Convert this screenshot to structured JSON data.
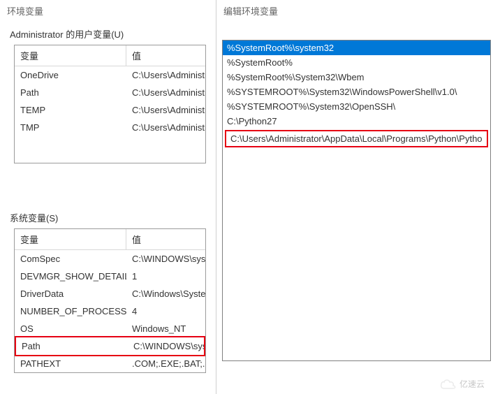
{
  "left": {
    "title": "环境变量",
    "user_section": "Administrator 的用户变量(U)",
    "sys_section": "系统变量(S)",
    "headers": {
      "name": "变量",
      "value": "值"
    },
    "user_vars": [
      {
        "name": "OneDrive",
        "value": "C:\\Users\\Administr"
      },
      {
        "name": "Path",
        "value": "C:\\Users\\Administr"
      },
      {
        "name": "TEMP",
        "value": "C:\\Users\\Administr"
      },
      {
        "name": "TMP",
        "value": "C:\\Users\\Administr"
      }
    ],
    "sys_vars": [
      {
        "name": "ComSpec",
        "value": "C:\\WINDOWS\\syste",
        "hl": false
      },
      {
        "name": "DEVMGR_SHOW_DETAILS",
        "value": "1",
        "hl": false
      },
      {
        "name": "DriverData",
        "value": "C:\\Windows\\Syster",
        "hl": false
      },
      {
        "name": "NUMBER_OF_PROCESSORS",
        "value": "4",
        "hl": false
      },
      {
        "name": "OS",
        "value": "Windows_NT",
        "hl": false
      },
      {
        "name": "Path",
        "value": "C:\\WINDOWS\\syste",
        "hl": true
      },
      {
        "name": "PATHEXT",
        "value": ".COM;.EXE;.BAT;.CM",
        "hl": false
      }
    ]
  },
  "right": {
    "title": "编辑环境变量",
    "paths": [
      {
        "text": "%SystemRoot%\\system32",
        "selected": true,
        "hl": false
      },
      {
        "text": "%SystemRoot%",
        "selected": false,
        "hl": false
      },
      {
        "text": "%SystemRoot%\\System32\\Wbem",
        "selected": false,
        "hl": false
      },
      {
        "text": "%SYSTEMROOT%\\System32\\WindowsPowerShell\\v1.0\\",
        "selected": false,
        "hl": false
      },
      {
        "text": "%SYSTEMROOT%\\System32\\OpenSSH\\",
        "selected": false,
        "hl": false
      },
      {
        "text": "C:\\Python27",
        "selected": false,
        "hl": false
      },
      {
        "text": "C:\\Users\\Administrator\\AppData\\Local\\Programs\\Python\\Pytho",
        "selected": false,
        "hl": true
      }
    ]
  },
  "watermark": "亿速云"
}
